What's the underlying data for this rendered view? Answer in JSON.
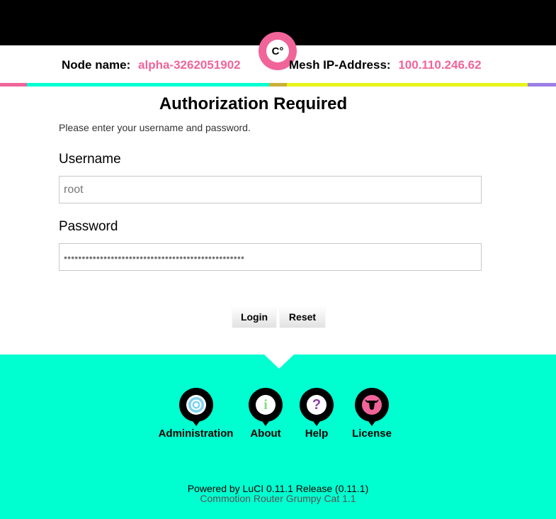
{
  "header": {
    "logo_text": "C°",
    "node_label": "Node name:",
    "node_value": "alpha-3262051902",
    "mesh_label": "Mesh IP-Address:",
    "mesh_value": "100.110.246.62"
  },
  "colors": {
    "pink": "#f0649a",
    "teal": "#00ffd0",
    "yellow": "#e8f51a",
    "purple": "#9b7fe6",
    "olive": "#c9b03a"
  },
  "auth": {
    "title": "Authorization Required",
    "intro": "Please enter your username and password.",
    "username_label": "Username",
    "username_value": "root",
    "password_label": "Password",
    "password_mask": "••••••••••••••••••••••••••••••••••••••••••••••••••",
    "login_label": "Login",
    "reset_label": "Reset"
  },
  "footer": {
    "items": [
      {
        "label": "Administration",
        "icon": "target-icon"
      },
      {
        "label": "About",
        "icon": "info-icon"
      },
      {
        "label": "Help",
        "icon": "question-icon"
      },
      {
        "label": "License",
        "icon": "bull-icon"
      }
    ],
    "powered": "Powered by LuCI 0.11.1 Release (0.11.1)",
    "variant": "Commotion Router Grumpy Cat 1.1"
  }
}
